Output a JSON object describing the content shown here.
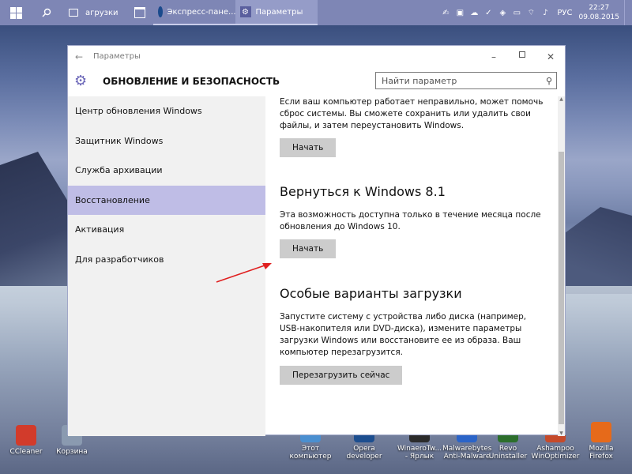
{
  "taskbar": {
    "search_label": "агрузки",
    "apps": [
      {
        "label": "Экспресс-пане..."
      },
      {
        "label": "Параметры"
      }
    ],
    "language": "РУС",
    "time": "22:27",
    "date": "09.08.2015"
  },
  "window": {
    "title": "Параметры",
    "header_title": "ОБНОВЛЕНИЕ И БЕЗОПАСНОСТЬ",
    "search_placeholder": "Найти параметр",
    "sidebar": [
      {
        "label": "Центр обновления Windows"
      },
      {
        "label": "Защитник Windows"
      },
      {
        "label": "Служба архивации"
      },
      {
        "label": "Восстановление",
        "selected": true
      },
      {
        "label": "Активация"
      },
      {
        "label": "Для разработчиков"
      }
    ],
    "content": {
      "reset_text": "Если ваш компьютер работает неправильно, может помочь сброс системы. Вы сможете сохранить или удалить свои файлы, и затем переустановить Windows.",
      "reset_button": "Начать",
      "rollback_title": "Вернуться к Windows 8.1",
      "rollback_text": "Эта возможность доступна только в течение месяца после обновления до Windows 10.",
      "rollback_button": "Начать",
      "advanced_title": "Особые варианты загрузки",
      "advanced_text": "Запустите систему с устройства либо диска (например, USB-накопителя или DVD-диска), измените параметры загрузки Windows или восстановите ее из образа. Ваш компьютер перезагрузится.",
      "advanced_button": "Перезагрузить сейчас"
    }
  },
  "desktop_icons": [
    {
      "label": "CCleaner",
      "color": "#d23b2b"
    },
    {
      "label": "Корзина",
      "color": "#8a9ab0"
    },
    {
      "label": "Этот компьютер",
      "color": "#4a8fd0"
    },
    {
      "label": "Opera developer",
      "color": "#1c4e8f"
    },
    {
      "label": "WinaeroTw... - Ярлык",
      "color": "#2b2b2b"
    },
    {
      "label": "Malwarebytes Anti-Malware",
      "color": "#2b64c8"
    },
    {
      "label": "Revo Uninstaller",
      "color": "#2c6e2c"
    },
    {
      "label": "Ashampoo WinOptimizer",
      "color": "#c64a2a"
    },
    {
      "label": "Mozilla Firefox",
      "color": "#e66a1a"
    }
  ],
  "colors": {
    "taskbar": "#7e86b5",
    "accent": "#6b66b8",
    "selected_item": "#bfbde6",
    "annotation_arrow": "#e02020"
  }
}
